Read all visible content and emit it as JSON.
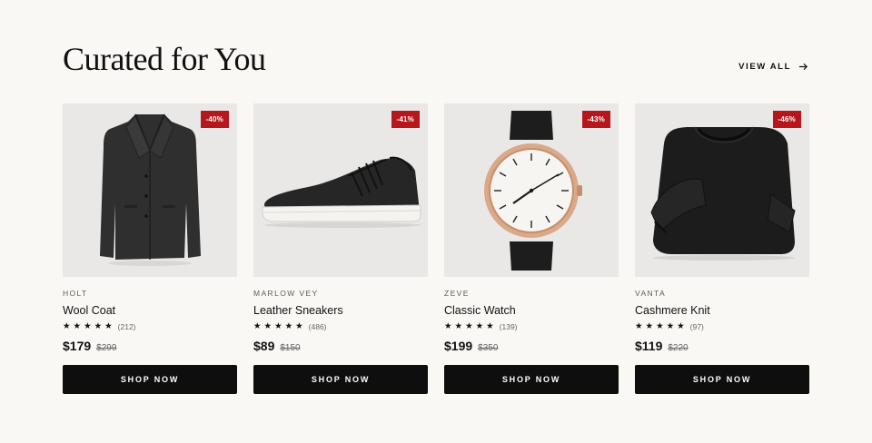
{
  "section": {
    "title": "Curated for You",
    "view_all": "VIEW ALL"
  },
  "icons": {
    "view_all": "arrow-right-icon",
    "rating": "star-icon"
  },
  "colors": {
    "badge": "#b5171d",
    "button": "#0e0e0e",
    "background": "#f9f8f5"
  },
  "products": [
    {
      "brand": "HOLT",
      "name": "Wool Coat",
      "rating": 5,
      "reviews": "(212)",
      "price": "$179",
      "old_price": "$299",
      "discount": "-40%",
      "cta": "SHOP NOW"
    },
    {
      "brand": "MARLOW VEY",
      "name": "Leather Sneakers",
      "rating": 5,
      "reviews": "(486)",
      "price": "$89",
      "old_price": "$150",
      "discount": "-41%",
      "cta": "SHOP NOW"
    },
    {
      "brand": "ZEVE",
      "name": "Classic Watch",
      "rating": 5,
      "reviews": "(139)",
      "price": "$199",
      "old_price": "$350",
      "discount": "-43%",
      "cta": "SHOP NOW"
    },
    {
      "brand": "VANTA",
      "name": "Cashmere Knit",
      "rating": 5,
      "reviews": "(97)",
      "price": "$119",
      "old_price": "$220",
      "discount": "-46%",
      "cta": "SHOP NOW"
    }
  ]
}
